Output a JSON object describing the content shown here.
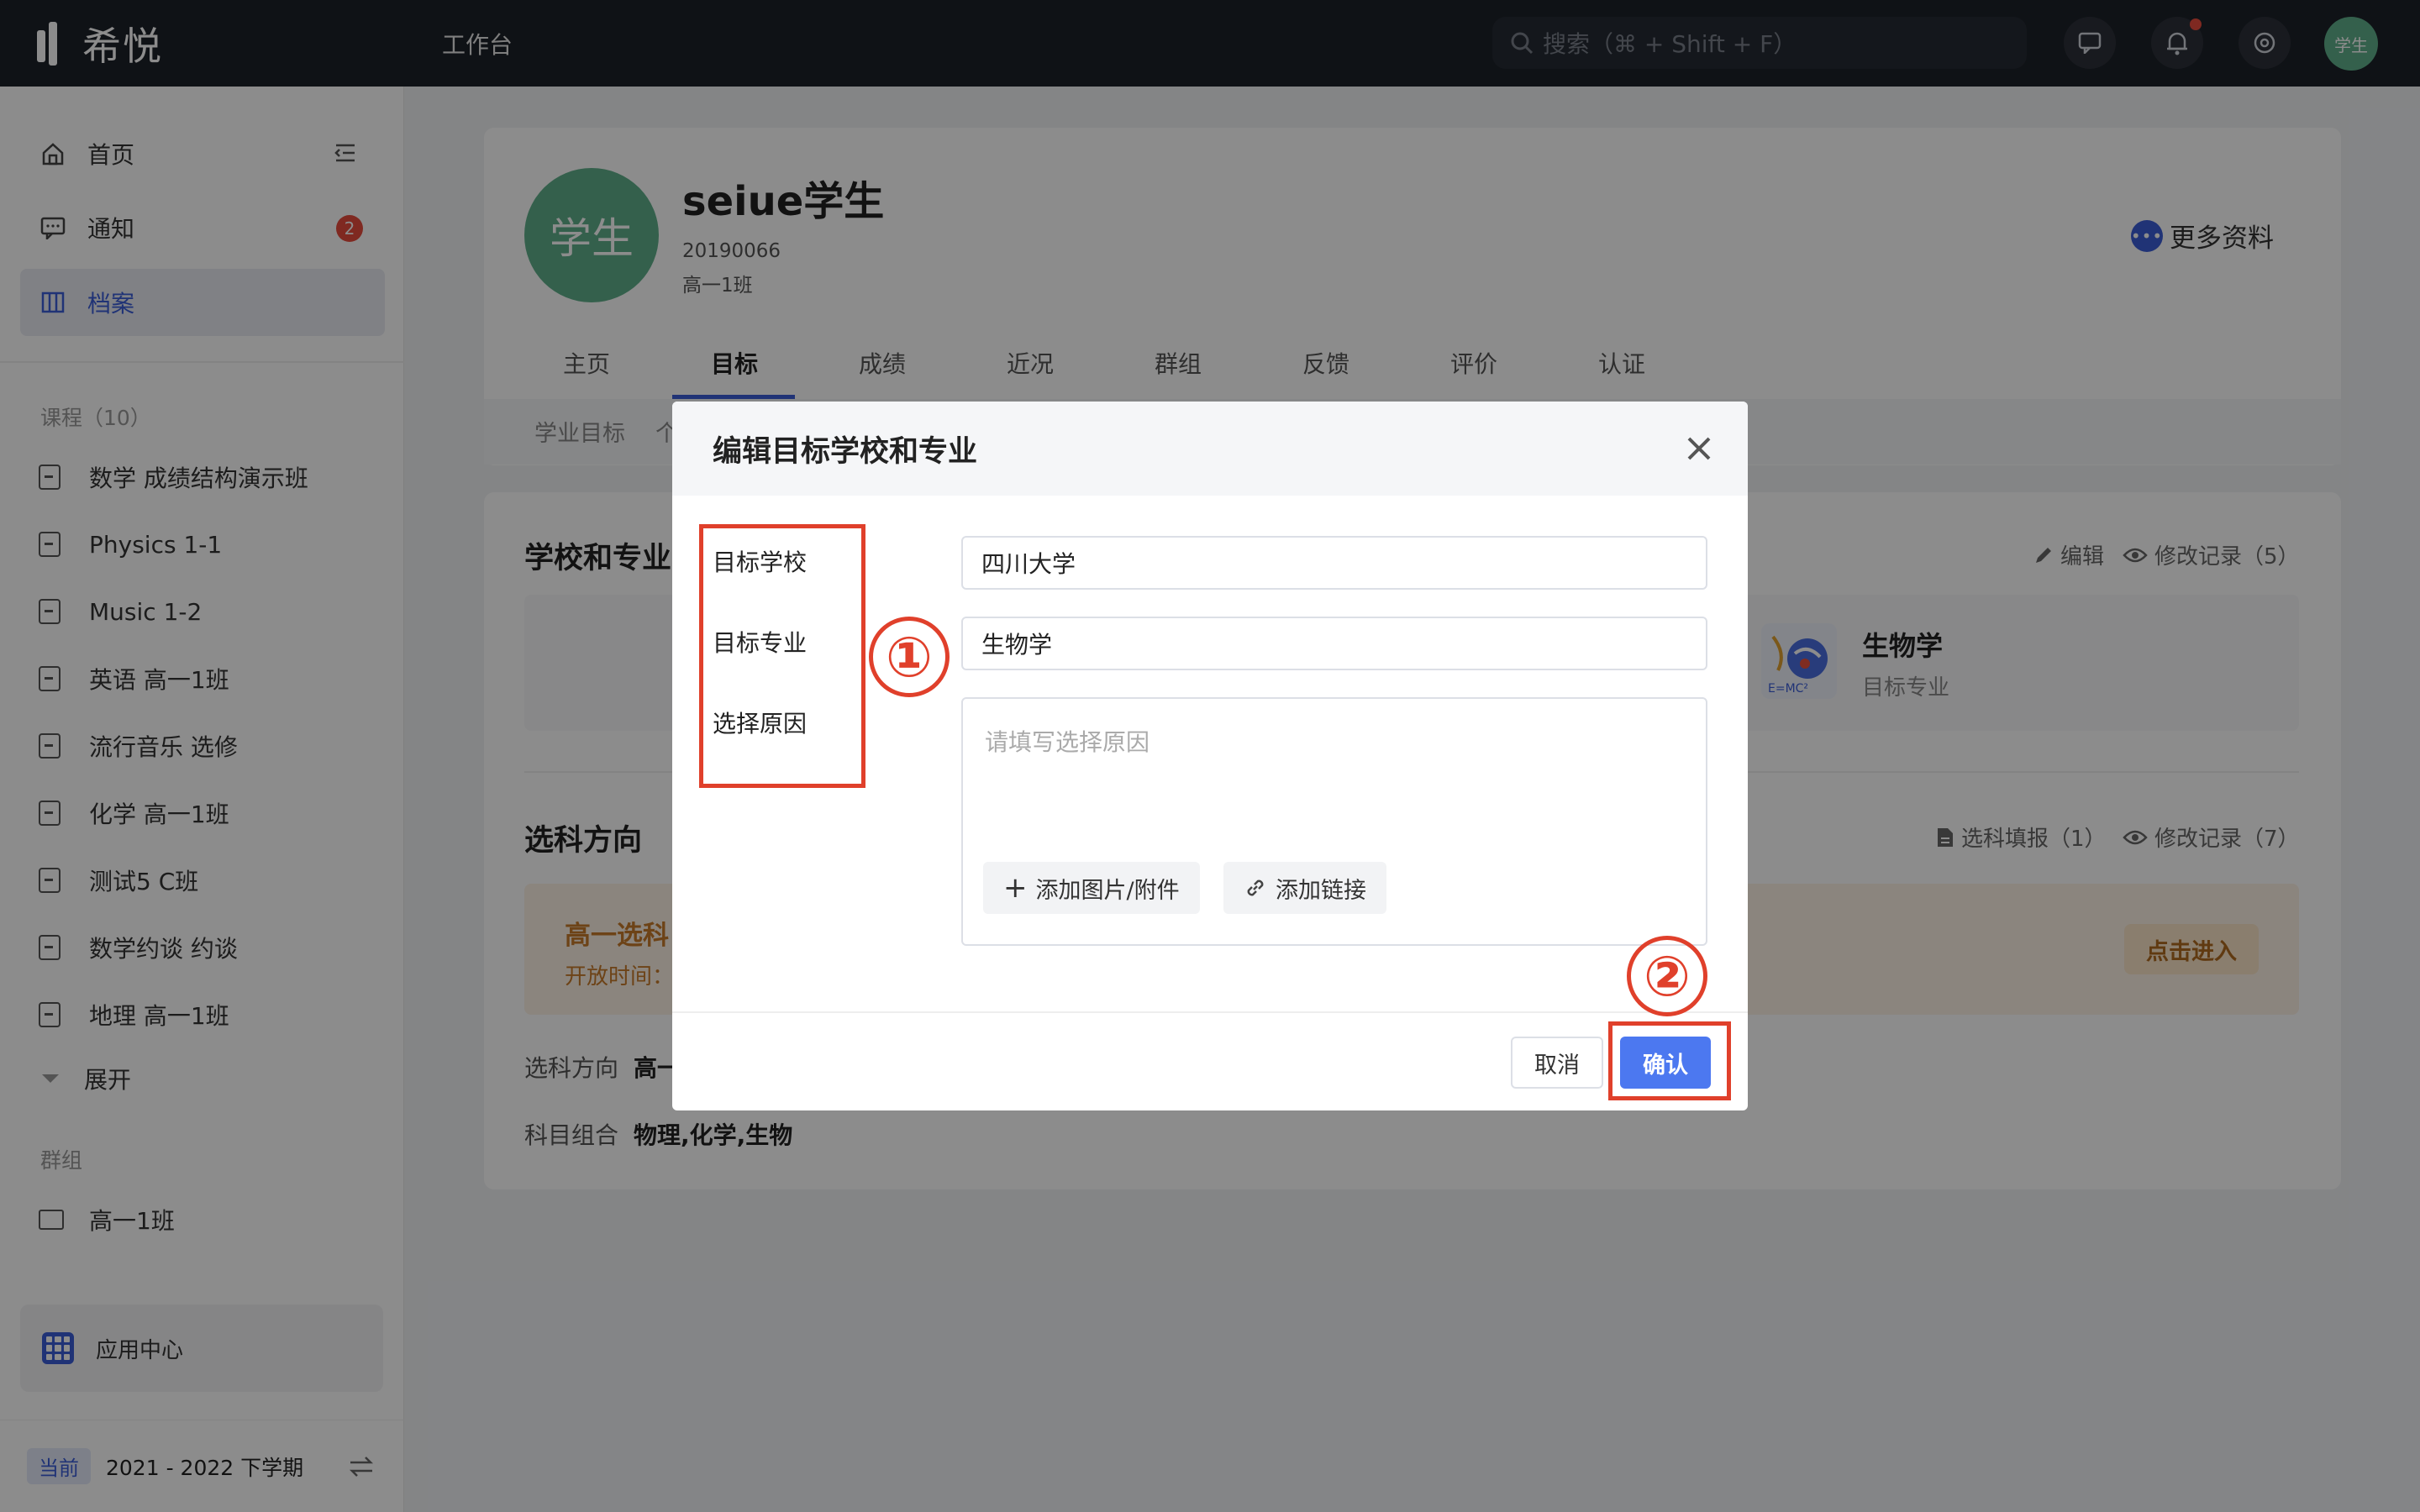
{
  "topbar": {
    "brand": "希悦",
    "workbench": "工作台",
    "search_placeholder": "搜索（⌘ + Shift + F）",
    "avatar": "学生",
    "icons": [
      "message-icon",
      "bell-icon",
      "settings-icon"
    ],
    "bg": "#1d2129"
  },
  "sidebar": {
    "nav": [
      {
        "label": "首页",
        "icon": "home-icon"
      },
      {
        "label": "通知",
        "icon": "message-icon",
        "badge": "2"
      },
      {
        "label": "档案",
        "icon": "archive-icon",
        "active": true
      }
    ],
    "courses_title": "课程（10）",
    "courses": [
      "数学 成绩结构演示班",
      "Physics 1-1",
      "Music 1-2",
      "英语 高一1班",
      "流行音乐 选修",
      "化学 高一1班",
      "测试5 C班",
      "数学约谈 约谈",
      "地理 高一1班"
    ],
    "expand": "展开",
    "groups_title": "群组",
    "groups": [
      "高一1班"
    ],
    "app_center": "应用中心",
    "term_tag": "当前",
    "term": "2021 - 2022 下学期"
  },
  "profile": {
    "avatar": "学生",
    "name": "seiue学生",
    "student_id": "20190066",
    "class": "高一1班",
    "more": "更多资料",
    "tabs": [
      "主页",
      "目标",
      "成绩",
      "近况",
      "群组",
      "反馈",
      "评价",
      "认证"
    ],
    "active_tab": "目标",
    "subtabs": [
      "学业目标",
      "个"
    ]
  },
  "school_section": {
    "title": "学校和专业",
    "edit": "编辑",
    "history": "修改记录（5）",
    "major": "生物学",
    "major_label": "目标专业"
  },
  "subject_section": {
    "title": "选科方向",
    "fill": "选科填报（1）",
    "history": "修改记录（7）",
    "banner_title": "高一选科",
    "banner_sub": "开放时间：",
    "enter": "点击进入",
    "direction_label": "选科方向",
    "direction_value": "高一",
    "combo_label": "科目组合",
    "combo_value": "物理,化学,生物"
  },
  "modal": {
    "title": "编辑目标学校和专业",
    "school_label": "目标学校",
    "school_value": "四川大学",
    "major_label": "目标专业",
    "major_value": "生物学",
    "reason_label": "选择原因",
    "reason_placeholder": "请填写选择原因",
    "add_attachment": "添加图片/附件",
    "add_link": "添加链接",
    "cancel": "取消",
    "confirm": "确认"
  },
  "annotations": {
    "step1": "①",
    "step2": "②",
    "color": "#e0402b"
  },
  "colors": {
    "accent": "#3b5dd8",
    "primary_button": "#4c78f0",
    "avatar_green": "#5fb08a"
  }
}
